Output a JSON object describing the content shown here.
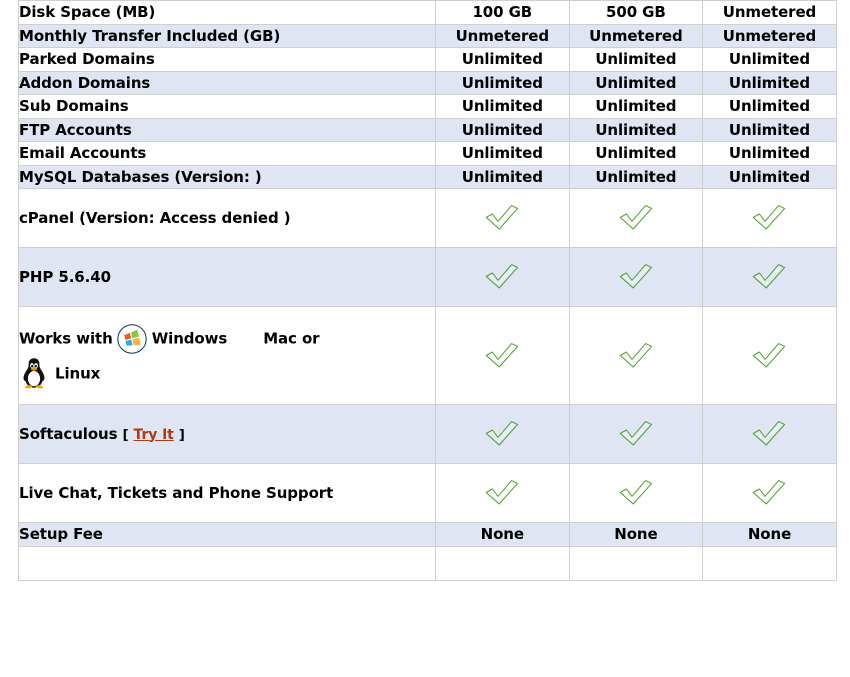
{
  "table": {
    "columns": [
      {
        "key": "feature",
        "header": ""
      },
      {
        "key": "plan1",
        "header": ""
      },
      {
        "key": "plan2",
        "header": ""
      },
      {
        "key": "plan3",
        "header": ""
      }
    ],
    "rows": [
      {
        "feature": "Disk Space (MB)",
        "values": [
          "100 GB",
          "500 GB",
          "Unmetered"
        ],
        "type": "text",
        "shade": "plain"
      },
      {
        "feature": "Monthly Transfer Included (GB)",
        "values": [
          "Unmetered",
          "Unmetered",
          "Unmetered"
        ],
        "type": "text",
        "shade": "alt"
      },
      {
        "feature": "Parked Domains",
        "values": [
          "Unlimited",
          "Unlimited",
          "Unlimited"
        ],
        "type": "text",
        "shade": "plain"
      },
      {
        "feature": "Addon Domains",
        "values": [
          "Unlimited",
          "Unlimited",
          "Unlimited"
        ],
        "type": "text",
        "shade": "alt"
      },
      {
        "feature": "Sub Domains",
        "values": [
          "Unlimited",
          "Unlimited",
          "Unlimited"
        ],
        "type": "text",
        "shade": "plain"
      },
      {
        "feature": "FTP Accounts",
        "values": [
          "Unlimited",
          "Unlimited",
          "Unlimited"
        ],
        "type": "text",
        "shade": "alt"
      },
      {
        "feature": "Email Accounts",
        "values": [
          "Unlimited",
          "Unlimited",
          "Unlimited"
        ],
        "type": "text",
        "shade": "plain"
      },
      {
        "feature": "MySQL Databases (Version: )",
        "values": [
          "Unlimited",
          "Unlimited",
          "Unlimited"
        ],
        "type": "text",
        "shade": "alt"
      },
      {
        "feature": "cPanel (Version: Access denied )",
        "values": [
          "check",
          "check",
          "check"
        ],
        "type": "check",
        "shade": "plain"
      },
      {
        "feature": "PHP 5.6.40",
        "values": [
          "check",
          "check",
          "check"
        ],
        "type": "check",
        "shade": "alt"
      },
      {
        "feature": "Works with Windows Mac or Linux",
        "values": [
          "check",
          "check",
          "check"
        ],
        "type": "check-os",
        "shade": "plain"
      },
      {
        "feature": "Softaculous",
        "values": [
          "check",
          "check",
          "check"
        ],
        "type": "check-link",
        "shade": "alt"
      },
      {
        "feature": "Live Chat, Tickets and Phone Support",
        "values": [
          "check",
          "check",
          "check"
        ],
        "type": "check",
        "shade": "plain"
      },
      {
        "feature": "Setup Fee",
        "values": [
          "None",
          "None",
          "None"
        ],
        "type": "text",
        "shade": "alt"
      },
      {
        "feature": "",
        "values": [
          "",
          "",
          ""
        ],
        "type": "text",
        "shade": "plain"
      }
    ]
  },
  "os_row": {
    "prefix": "Works with",
    "windows_label": "Windows",
    "mac_label": "Mac or",
    "linux_label": "Linux",
    "windows_icon": "windows-logo-icon",
    "mac_icon": "apple-logo-icon",
    "linux_icon": "linux-penguin-icon"
  },
  "softaculous_row": {
    "label": "Softaculous",
    "bracket_open": "[",
    "link_text": "Try It",
    "bracket_close": "]"
  },
  "icons": {
    "check": "green-check-icon"
  },
  "colors": {
    "row_alt_bg": "#dfe5f3",
    "row_plain_bg": "#ffffff",
    "border": "#cfcfcf",
    "text": "#000000",
    "link": "#b03a10",
    "check_green": "#6cc04a"
  }
}
